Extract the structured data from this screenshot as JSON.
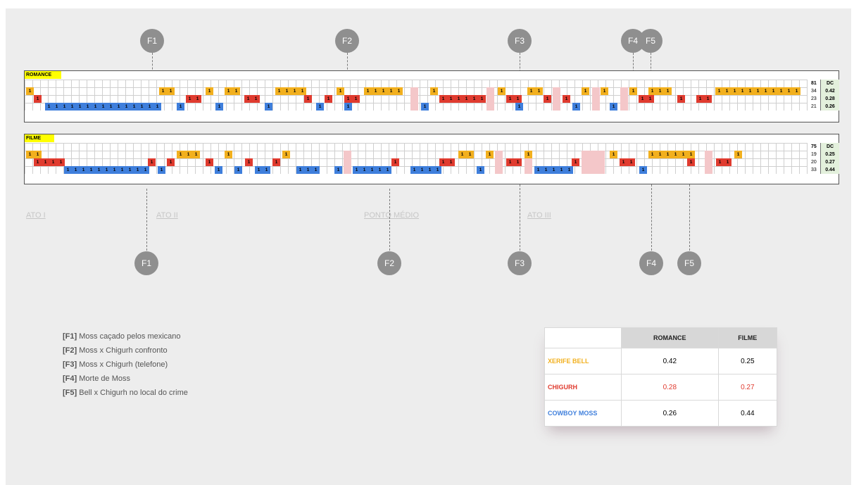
{
  "colors": {
    "bell": "#f2b01e",
    "chigurh": "#e03b2f",
    "moss": "#3f7fdc",
    "pink": "#f4c7c9",
    "marker": "#8f8f8f",
    "title_bg": "#ffff00"
  },
  "markers_top": [
    {
      "label": "F1"
    },
    {
      "label": "F2"
    },
    {
      "label": "F3"
    },
    {
      "label": "F4"
    },
    {
      "label": "F5"
    }
  ],
  "markers_bottom": [
    {
      "label": "F1"
    },
    {
      "label": "F2"
    },
    {
      "label": "F3"
    },
    {
      "label": "F4"
    },
    {
      "label": "F5"
    }
  ],
  "romance": {
    "title": "ROMANCE",
    "total": "81",
    "dc_header": "DC",
    "rows": [
      {
        "character": "Xerife Bell",
        "count": "34",
        "dc": "0.42"
      },
      {
        "character": "Chigurh",
        "count": "23",
        "dc": "0.28"
      },
      {
        "character": "Cowboy Moss",
        "count": "21",
        "dc": "0.26"
      }
    ]
  },
  "filme": {
    "title": "FILME",
    "total": "75",
    "dc_header": "DC",
    "rows": [
      {
        "character": "Xerife Bell",
        "count": "19",
        "dc": "0.25"
      },
      {
        "character": "Chigurh",
        "count": "20",
        "dc": "0.27"
      },
      {
        "character": "Cowboy Moss",
        "count": "33",
        "dc": "0.44"
      }
    ]
  },
  "acts": [
    "ATO I",
    "ATO II",
    "PONTO MÉDIO",
    "ATO III"
  ],
  "legend": [
    {
      "code": "[F1]",
      "text": " Moss caçado pelos mexicano"
    },
    {
      "code": "[F2]",
      "text": " Moss x Chigurh confronto"
    },
    {
      "code": "[F3]",
      "text": " Moss x Chigurh (telefone)"
    },
    {
      "code": "[F4]",
      "text": " Morte de Moss"
    },
    {
      "code": "[F5]",
      "text": " Bell x Chigurh no local do crime"
    }
  ],
  "table": {
    "headers": [
      "ROMANCE",
      "FILME"
    ],
    "rows": [
      {
        "label": "XERIFE BELL",
        "romance": "0.42",
        "filme": "0.25",
        "color": "#f2b01e",
        "value_color": "#222"
      },
      {
        "label": "CHIGURH",
        "romance": "0.28",
        "filme": "0.27",
        "color": "#e03b2f",
        "value_color": "#e03b2f"
      },
      {
        "label": "COWBOY MOSS",
        "romance": "0.26",
        "filme": "0.44",
        "color": "#3f7fdc",
        "value_color": "#222"
      }
    ]
  },
  "cell_value": "1"
}
